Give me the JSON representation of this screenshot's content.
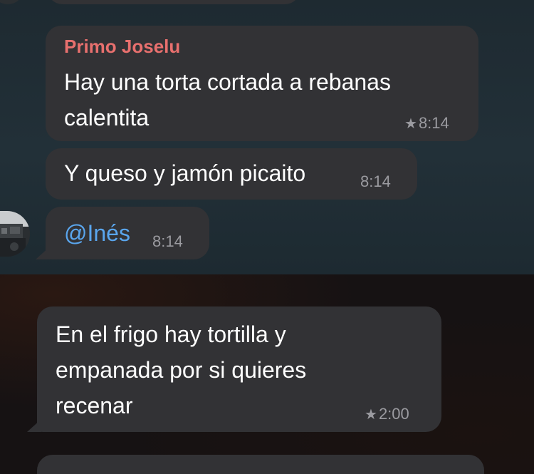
{
  "chat": {
    "messages": [
      {
        "sender": "Primo Joselu",
        "lines": [
          "Hay una torta cortada a rebanas",
          "calentita"
        ],
        "time": "8:14",
        "starred": true
      },
      {
        "text": "Y queso y jamón picaito",
        "time": "8:14",
        "starred": false
      },
      {
        "mention": "@Inés",
        "time": "8:14",
        "starred": false
      },
      {
        "lines": [
          "En el frigo hay tortilla y",
          "empanada por si quieres",
          "recenar"
        ],
        "time": "2:00",
        "starred": true
      }
    ]
  },
  "icons": {
    "star": "star-icon",
    "avatar": "user-avatar"
  },
  "colors": {
    "bubble": "#323235",
    "sender_name": "#e8706e",
    "mention": "#5aa6ee",
    "timestamp": "#9b9ba0"
  }
}
